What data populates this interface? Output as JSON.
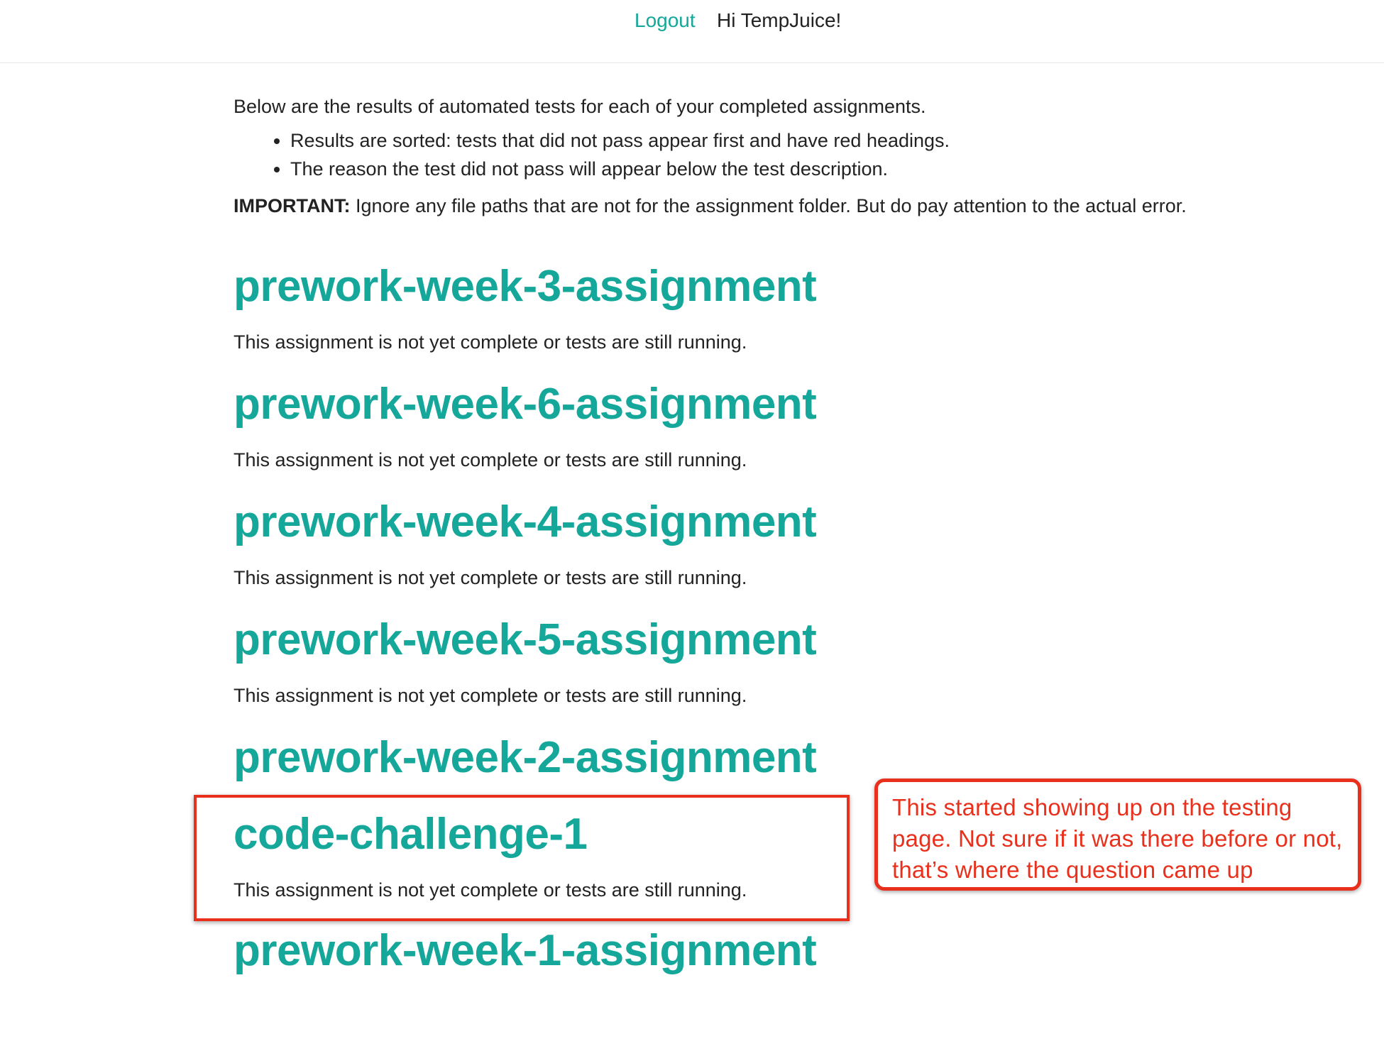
{
  "header": {
    "logout_label": "Logout",
    "greeting": "Hi TempJuice!"
  },
  "intro": {
    "text": "Below are the results of automated tests for each of your completed assignments.",
    "notes": [
      "Results are sorted: tests that did not pass appear first and have red headings.",
      "The reason the test did not pass will appear below the test description."
    ],
    "important_label": "IMPORTANT:",
    "important_text": " Ignore any file paths that are not for the assignment folder. But do pay attention to the actual error."
  },
  "assignments": [
    {
      "title": "prework-week-3-assignment",
      "status": "This assignment is not yet complete or tests are still running."
    },
    {
      "title": "prework-week-6-assignment",
      "status": "This assignment is not yet complete or tests are still running."
    },
    {
      "title": "prework-week-4-assignment",
      "status": "This assignment is not yet complete or tests are still running."
    },
    {
      "title": "prework-week-5-assignment",
      "status": "This assignment is not yet complete or tests are still running."
    },
    {
      "title": "prework-week-2-assignment",
      "status": ""
    },
    {
      "title": "code-challenge-1",
      "status": "This assignment is not yet complete or tests are still running."
    },
    {
      "title": "prework-week-1-assignment",
      "status": ""
    }
  ],
  "annotation": {
    "callout_text": "This started showing up on the testing page. Not sure if it was there before or not, that’s where the question came up",
    "color": "#e8301c"
  },
  "colors": {
    "accent": "#14a79a",
    "text": "#222222"
  }
}
